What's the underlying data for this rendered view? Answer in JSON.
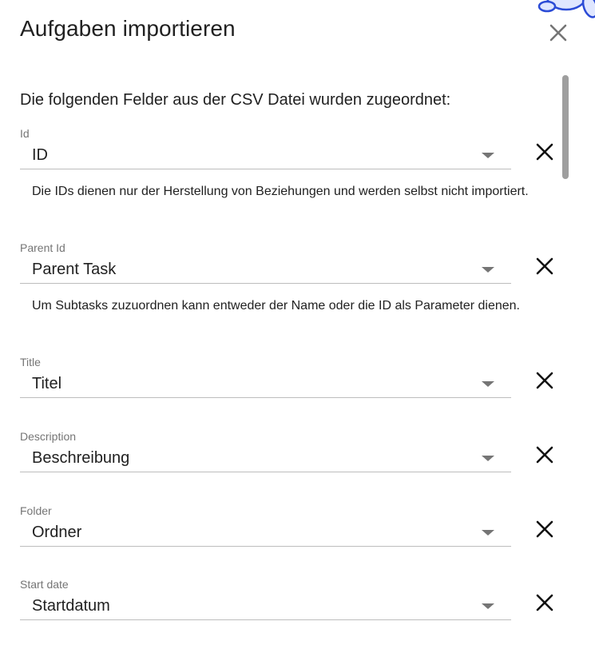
{
  "dialog": {
    "title": "Aufgaben importieren",
    "intro": "Die folgenden Felder aus der CSV Datei wurden zugeordnet:"
  },
  "icons": {
    "close": "close-icon",
    "remove": "close-icon",
    "dropdown": "arrow-drop-down-icon",
    "mascot": "mascot-illustration"
  },
  "colors": {
    "mascot_fill": "#dfe6ff",
    "mascot_stroke": "#2b4bd6",
    "mascot_accent": "#e53935"
  },
  "fields": [
    {
      "label": "Id",
      "value": "ID",
      "hint": "Die IDs dienen nur der Herstellung von Beziehungen und werden selbst nicht importiert."
    },
    {
      "label": "Parent Id",
      "value": "Parent Task",
      "hint": "Um Subtasks zuzuordnen kann entweder der Name oder die ID als Parameter dienen."
    },
    {
      "label": "Title",
      "value": "Titel"
    },
    {
      "label": "Description",
      "value": "Beschreibung"
    },
    {
      "label": "Folder",
      "value": "Ordner"
    },
    {
      "label": "Start date",
      "value": "Startdatum"
    }
  ]
}
